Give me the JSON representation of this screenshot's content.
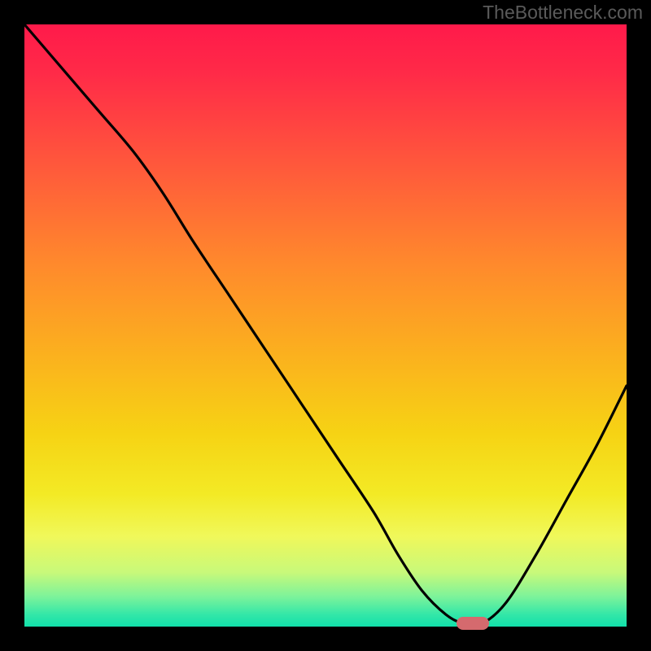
{
  "watermark": "TheBottleneck.com",
  "colors": {
    "page_bg": "#000000",
    "curve_stroke": "#000000",
    "marker_fill": "#d56a6e",
    "watermark_text": "#5a5a5a"
  },
  "chart_data": {
    "type": "line",
    "title": "",
    "xlabel": "",
    "ylabel": "",
    "xlim": [
      0,
      100
    ],
    "ylim": [
      0,
      100
    ],
    "grid": false,
    "annotations": [
      "TheBottleneck.com"
    ],
    "series": [
      {
        "name": "bottleneck-curve",
        "x": [
          0,
          6,
          12,
          18,
          23,
          28,
          34,
          40,
          46,
          52,
          58,
          62,
          66,
          70,
          73,
          76,
          80,
          85,
          90,
          95,
          100
        ],
        "values": [
          100,
          93,
          86,
          79,
          72,
          64,
          55,
          46,
          37,
          28,
          19,
          12,
          6,
          2,
          0.5,
          0.5,
          4,
          12,
          21,
          30,
          40
        ]
      }
    ],
    "marker": {
      "x": 74.5,
      "y": 0.5
    },
    "gradient_stops": [
      {
        "pos": 0,
        "color": "#ff1a4a"
      },
      {
        "pos": 8,
        "color": "#ff2a48"
      },
      {
        "pos": 25,
        "color": "#ff5d3a"
      },
      {
        "pos": 40,
        "color": "#ff8a2c"
      },
      {
        "pos": 55,
        "color": "#fbb11e"
      },
      {
        "pos": 68,
        "color": "#f6d314"
      },
      {
        "pos": 78,
        "color": "#f3ea25"
      },
      {
        "pos": 85,
        "color": "#f0f85a"
      },
      {
        "pos": 91,
        "color": "#c8f97a"
      },
      {
        "pos": 95,
        "color": "#7df39a"
      },
      {
        "pos": 98,
        "color": "#33e7a8"
      },
      {
        "pos": 100,
        "color": "#11e0aa"
      }
    ]
  }
}
